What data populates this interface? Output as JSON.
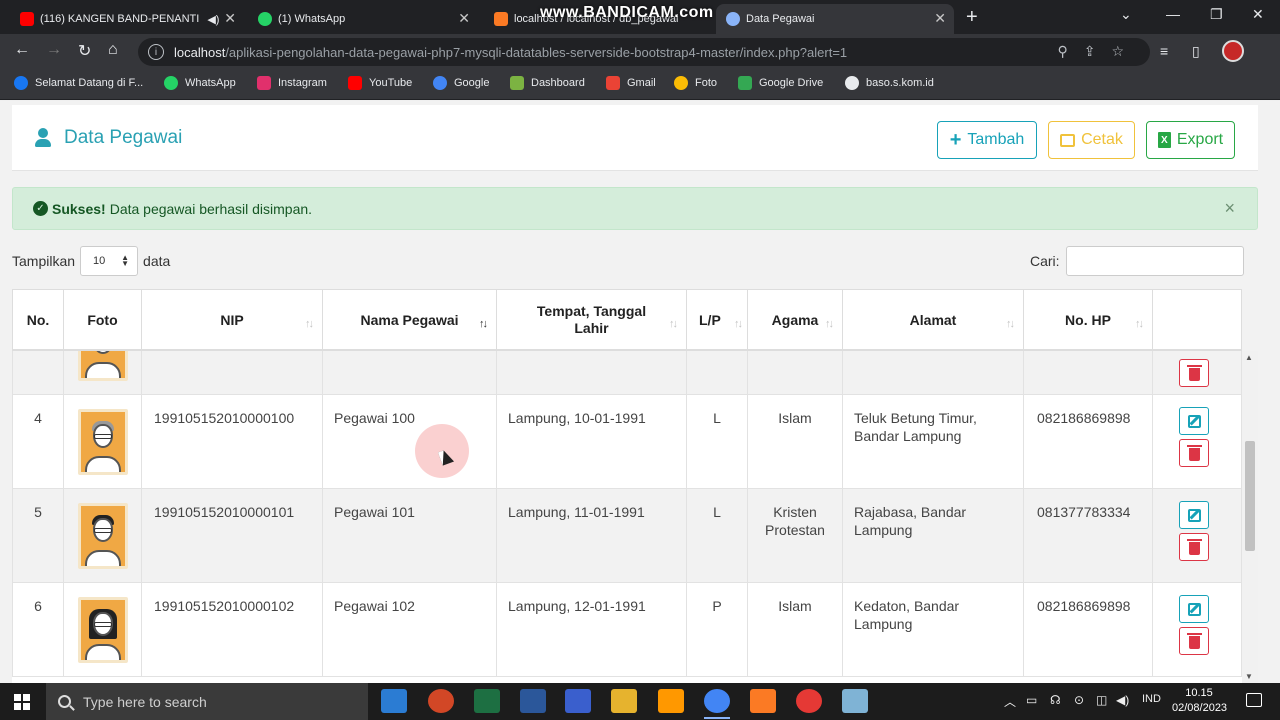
{
  "browser": {
    "tabs": [
      {
        "title": "(116) KANGEN BAND-PENANTI",
        "icon": "youtube-icon"
      },
      {
        "title": "(1) WhatsApp",
        "icon": "whatsapp-icon"
      },
      {
        "title": "localhost / localhost / db_pegawai",
        "icon": "phpmyadmin-icon"
      },
      {
        "title": "Data Pegawai",
        "icon": "globe-icon"
      }
    ],
    "watermark": "www.BANDICAM.com",
    "url_host": "localhost",
    "url_path": "/aplikasi-pengolahan-data-pegawai-php7-mysqli-datatables-serverside-bootstrap4-master/index.php?alert=1",
    "bookmarks": [
      {
        "label": "Selamat Datang di F...",
        "color": "#1877f2"
      },
      {
        "label": "WhatsApp",
        "color": "#25d366"
      },
      {
        "label": "Instagram",
        "color": "#e1306c"
      },
      {
        "label": "YouTube",
        "color": "#ff0000"
      },
      {
        "label": "Google",
        "color": "#4285f4"
      },
      {
        "label": "Dashboard",
        "color": "#7cb342"
      },
      {
        "label": "Gmail",
        "color": "#ea4335"
      },
      {
        "label": "Foto",
        "color": "#fbbc05"
      },
      {
        "label": "Google Drive",
        "color": "#34a853"
      },
      {
        "label": "baso.s.kom.id",
        "color": "#e8eaed"
      }
    ]
  },
  "header": {
    "title": "Data Pegawai",
    "buttons": {
      "tambah": "Tambah",
      "cetak": "Cetak",
      "export": "Export"
    }
  },
  "alert": {
    "strong": "Sukses!",
    "message": "Data pegawai berhasil disimpan.",
    "close": "×"
  },
  "controls": {
    "show_label": "Tampilkan",
    "show_value": "10",
    "show_suffix": "data",
    "search_label": "Cari:"
  },
  "table": {
    "columns": [
      "No.",
      "Foto",
      "NIP",
      "Nama Pegawai",
      "Tempat, Tanggal Lahir",
      "L/P",
      "Agama",
      "Alamat",
      "No. HP"
    ],
    "rows": [
      {
        "no": "4",
        "nip": "199105152010000100",
        "nama": "Pegawai 100",
        "ttl": "Lampung, 10-01-1991",
        "lp": "L",
        "agama": "Islam",
        "alamat": "Teluk Betung Timur, Bandar Lampung",
        "hp": "082186869898"
      },
      {
        "no": "5",
        "nip": "199105152010000101",
        "nama": "Pegawai 101",
        "ttl": "Lampung, 11-01-1991",
        "lp": "L",
        "agama": "Kristen Protestan",
        "alamat": "Rajabasa, Bandar Lampung",
        "hp": "081377783334"
      },
      {
        "no": "6",
        "nip": "199105152010000102",
        "nama": "Pegawai 102",
        "ttl": "Lampung, 12-01-1991",
        "lp": "P",
        "agama": "Islam",
        "alamat": "Kedaton, Bandar Lampung",
        "hp": "082186869898"
      }
    ]
  },
  "taskbar": {
    "search_placeholder": "Type here to search",
    "lang": "IND",
    "time": "10.15",
    "date": "02/08/2023"
  },
  "colors": {
    "accent": "#17a2b8",
    "warning": "#f0c23b",
    "success": "#28a745",
    "danger": "#dc3545",
    "alert_bg": "#d4edda"
  }
}
